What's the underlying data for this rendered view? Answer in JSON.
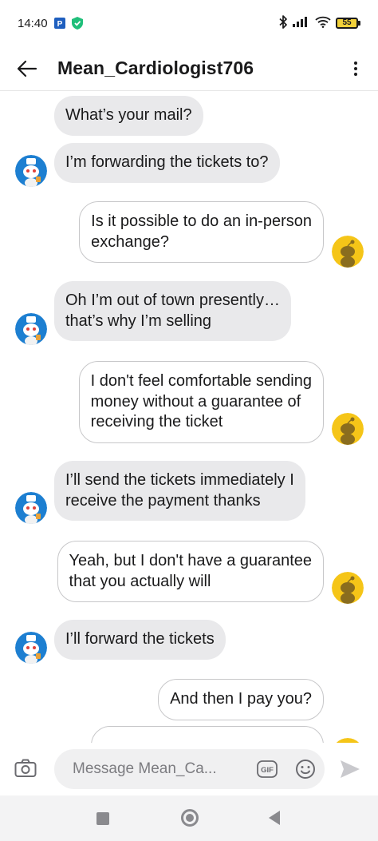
{
  "status_bar": {
    "time": "14:40",
    "battery": "55",
    "icons": [
      "paypal-icon",
      "vpn-shield-icon",
      "bluetooth-icon",
      "signal-icon",
      "wifi-icon",
      "battery-icon"
    ]
  },
  "header": {
    "title": "Mean_Cardiologist706",
    "back_icon": "back-arrow-icon",
    "more_icon": "more-vertical-icon"
  },
  "messages": [
    {
      "sender": "other",
      "text": "What’s your mail?"
    },
    {
      "sender": "other",
      "text": "I’m forwarding the tickets to?"
    },
    {
      "sender": "me",
      "text": "Is it possible to do an in-person\nexchange?"
    },
    {
      "sender": "other",
      "text": "Oh I’m out of town presently…\nthat’s why I’m selling"
    },
    {
      "sender": "me",
      "text": "I don't feel comfortable sending\nmoney without a guarantee of\nreceiving the ticket"
    },
    {
      "sender": "other",
      "text": "I’ll send the tickets immediately I\nreceive the payment thanks"
    },
    {
      "sender": "me",
      "text": "Yeah, but I don't have a guarantee\nthat you actually will"
    },
    {
      "sender": "other",
      "text": "I’ll forward the tickets"
    },
    {
      "sender": "me",
      "text": "And then I pay you?"
    }
  ],
  "composer": {
    "placeholder": "Message Mean_Ca...",
    "gif_label": "GIF",
    "icons": [
      "camera-icon",
      "gif-icon",
      "emoji-icon",
      "send-icon"
    ]
  },
  "colors": {
    "incoming_bubble": "#e9e9eb",
    "outgoing_border": "#c7c7c9",
    "other_avatar_bg": "#1d7fd1",
    "my_avatar_bg": "#f5c518"
  }
}
